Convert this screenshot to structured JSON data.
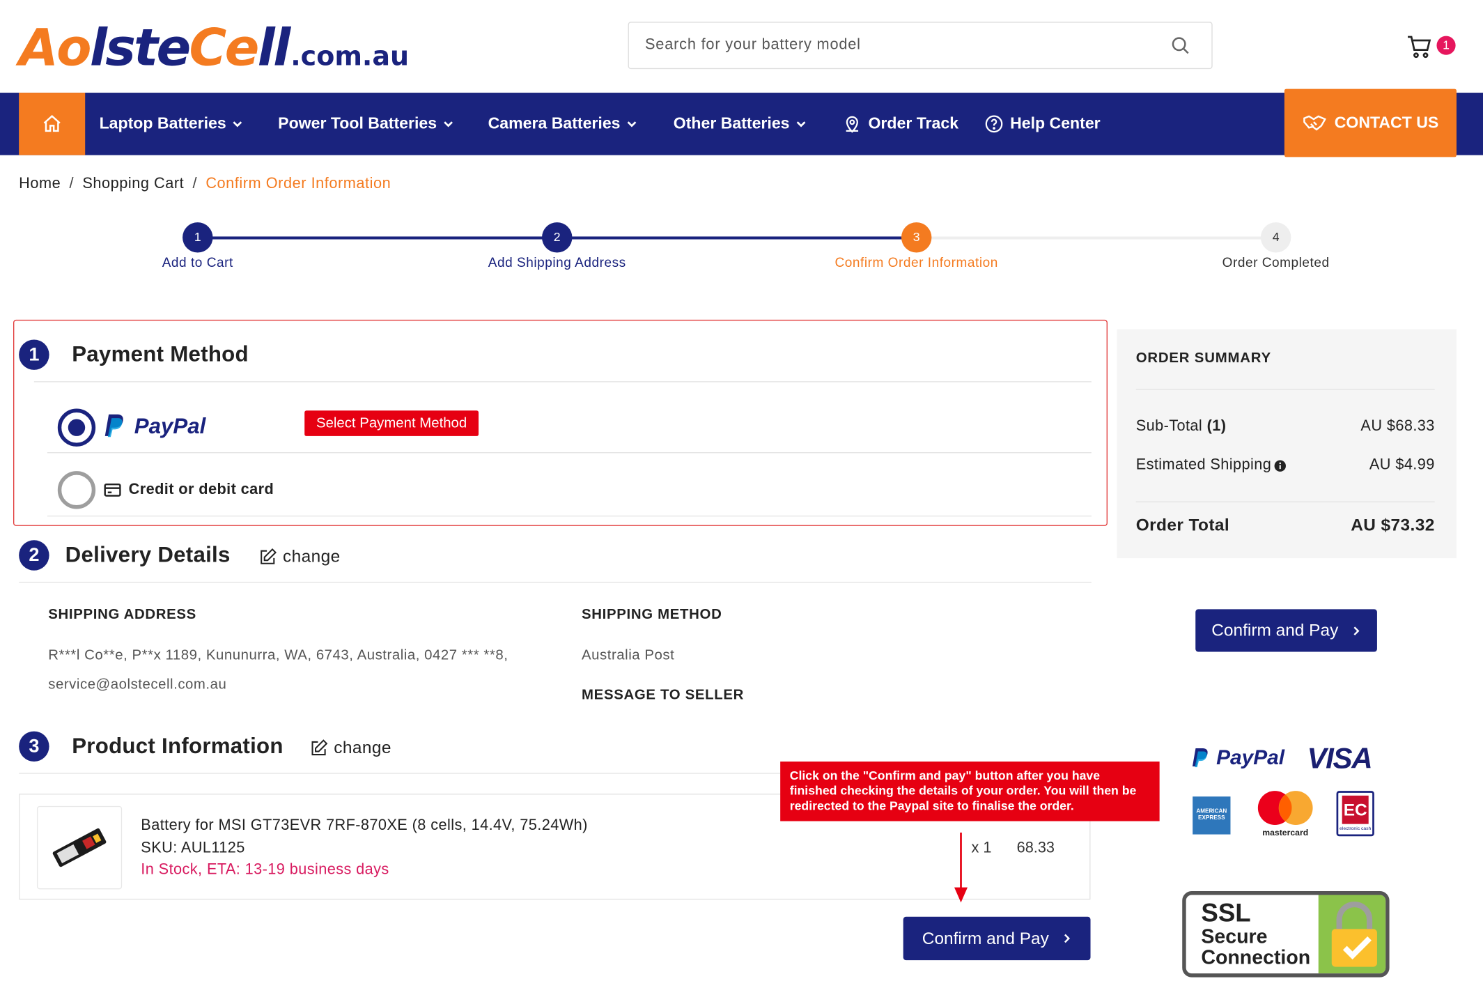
{
  "header": {
    "logo": {
      "part1": "Ao",
      "part2": "lste",
      "part3": "Ce",
      "part4": "ll",
      "domain": ".com.au"
    },
    "search_placeholder": "Search for your battery model",
    "cart_count": "1"
  },
  "nav": {
    "items": [
      {
        "label": "Laptop Batteries"
      },
      {
        "label": "Power Tool Batteries"
      },
      {
        "label": "Camera Batteries"
      },
      {
        "label": "Other Batteries"
      },
      {
        "label": "Order Track"
      },
      {
        "label": "Help Center"
      }
    ],
    "contact": "CONTACT US"
  },
  "breadcrumb": {
    "home": "Home",
    "cart": "Shopping Cart",
    "current": "Confirm Order Information"
  },
  "steps": [
    {
      "num": "1",
      "label": "Add to Cart"
    },
    {
      "num": "2",
      "label": "Add Shipping Address"
    },
    {
      "num": "3",
      "label": "Confirm Order Information"
    },
    {
      "num": "4",
      "label": "Order Completed"
    }
  ],
  "payment": {
    "num": "1",
    "title": "Payment Method",
    "paypal_label": "PayPal",
    "select_label": "Select Payment Method",
    "card_label": "Credit or debit card"
  },
  "delivery": {
    "num": "2",
    "title": "Delivery Details",
    "change": "change",
    "shipping_address_label": "SHIPPING ADDRESS",
    "address_line1": "R***l Co**e, P**x 1189, Kununurra, WA, 6743, Australia, 0427 *** **8,",
    "address_line2": "service@aolstecell.com.au",
    "shipping_method_label": "SHIPPING METHOD",
    "shipping_method": "Australia Post",
    "message_label": "MESSAGE TO SELLER"
  },
  "product": {
    "num": "3",
    "title": "Product Information",
    "change": "change",
    "name": "Battery for MSI GT73EVR 7RF-870XE (8 cells, 14.4V, 75.24Wh)",
    "sku": "SKU: AUL1125",
    "stock": "In Stock, ETA: 13-19 business days",
    "qty": "x 1",
    "price": "68.33"
  },
  "tooltip": "Click on the \"Confirm and pay\" button after you have finished checking the details of your order. You will then be redirected to the Paypal site to finalise the order.",
  "confirm_button": "Confirm and Pay",
  "summary": {
    "title": "ORDER SUMMARY",
    "subtotal_label": "Sub-Total",
    "subtotal_count": "(1)",
    "subtotal": "AU $68.33",
    "shipping_label": "Estimated Shipping",
    "shipping": "AU $4.99",
    "total_label": "Order Total",
    "total": "AU $73.32"
  },
  "badges": {
    "paypal": "PayPal",
    "visa": "VISA",
    "amex": "AMERICAN EXPRESS",
    "mastercard": "mastercard",
    "ec": "electronic cash",
    "ssl_line1": "SSL",
    "ssl_line2": "Secure",
    "ssl_line3": "Connection"
  },
  "colors": {
    "brand_navy": "#1a237e",
    "brand_orange": "#f47b20",
    "alert_red": "#e60012",
    "stock_pink": "#d81b60"
  }
}
